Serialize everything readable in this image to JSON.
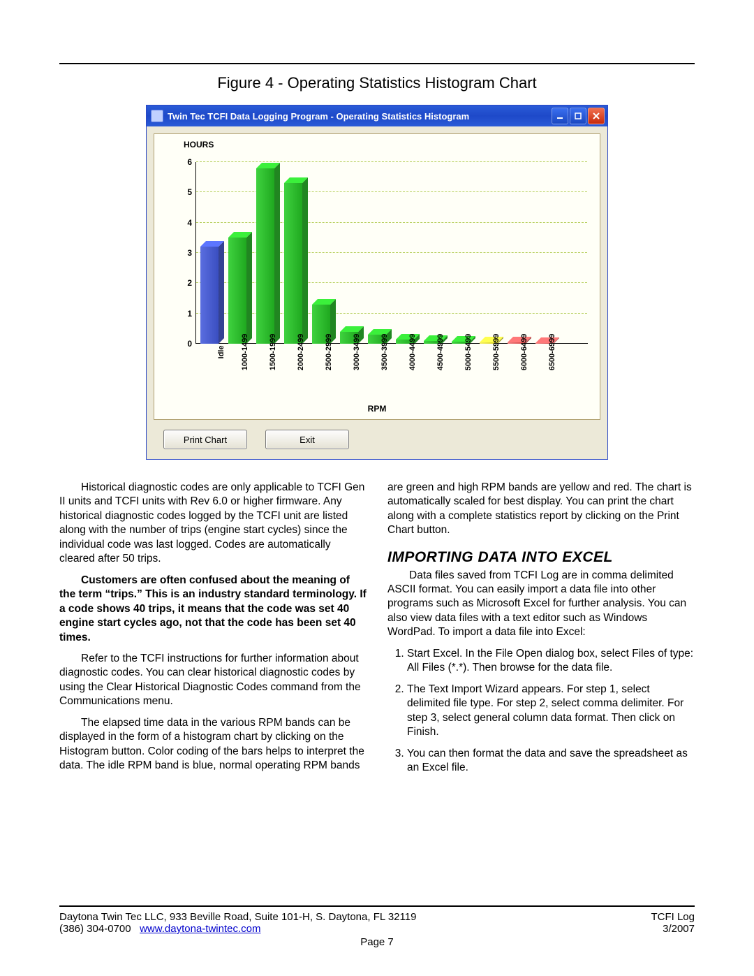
{
  "figure_caption": "Figure 4 - Operating Statistics Histogram Chart",
  "window": {
    "title": "Twin Tec TCFI Data Logging Program - Operating Statistics Histogram",
    "print_btn": "Print Chart",
    "exit_btn": "Exit"
  },
  "chart_data": {
    "type": "bar",
    "ylabel": "HOURS",
    "xlabel": "RPM",
    "ylim": [
      0,
      6
    ],
    "yticks": [
      0,
      1,
      2,
      3,
      4,
      5,
      6
    ],
    "categories": [
      "Idle",
      "1000-1499",
      "1500-1999",
      "2000-2499",
      "2500-2999",
      "3000-3499",
      "3500-3999",
      "4000-4499",
      "4500-4999",
      "5000-5499",
      "5500-5999",
      "6000-6499",
      "6500-6999"
    ],
    "values": [
      3.2,
      3.5,
      5.8,
      5.3,
      1.3,
      0.4,
      0.3,
      0.15,
      0.1,
      0.08,
      0.05,
      0.04,
      0.03
    ],
    "colors": [
      "blue",
      "green",
      "green",
      "green",
      "green",
      "green",
      "green",
      "green",
      "green",
      "green",
      "yellow",
      "red",
      "red"
    ]
  },
  "body": {
    "p1": "Historical diagnostic codes are only applicable to TCFI Gen II units and TCFI units with Rev 6.0 or higher firmware. Any historical diagnostic codes logged by the TCFI unit are listed along with the number of trips (engine start cycles) since the individual code was last logged. Codes are automatically cleared after 50 trips.",
    "p2": "Customers are often confused about the meaning of the term “trips.” This is an industry standard terminology. If a code shows 40 trips, it means that the code was set 40 engine start cycles ago, not that the code has been set 40 times.",
    "p3": "Refer to the TCFI instructions for further information about diagnostic codes.  You can clear historical diagnostic codes by using the Clear Historical Diagnostic Codes command from the Communications menu.",
    "p4": "The elapsed time data in the various RPM bands can be displayed in the form of a histogram chart by clicking on the Histogram button. Color coding of the bars helps to interpret the data. The idle RPM band is blue, normal operating RPM bands are green and high RPM bands are yellow and red. The chart is automatically scaled for best display. You can print the chart along with a complete statistics report by clicking on the Print Chart button.",
    "h2": "IMPORTING DATA INTO EXCEL",
    "p5": "Data files saved from TCFI Log are in comma delimited ASCII format. You can easily import a data file into other programs such as Microsoft Excel for further analysis. You can also view data files with a text editor such as Windows WordPad. To import a data file into Excel:",
    "li1": "Start Excel. In the File Open dialog box, select Files of type: All Files (*.*). Then browse for the data file.",
    "li2": "The Text Import Wizard appears. For step 1, select delimited file type. For step 2, select comma delimiter. For step 3, select general column data format. Then click on Finish.",
    "li3": "You can then format the data and save the spreadsheet as an Excel file."
  },
  "footer": {
    "addr": "Daytona Twin Tec LLC, 933 Beville Road, Suite 101-H, S. Daytona, FL 32119",
    "right1": "TCFI Log",
    "phone": "(386) 304-0700",
    "url": "www.daytona-twintec.com",
    "right2": "3/2007",
    "page": "Page 7"
  }
}
